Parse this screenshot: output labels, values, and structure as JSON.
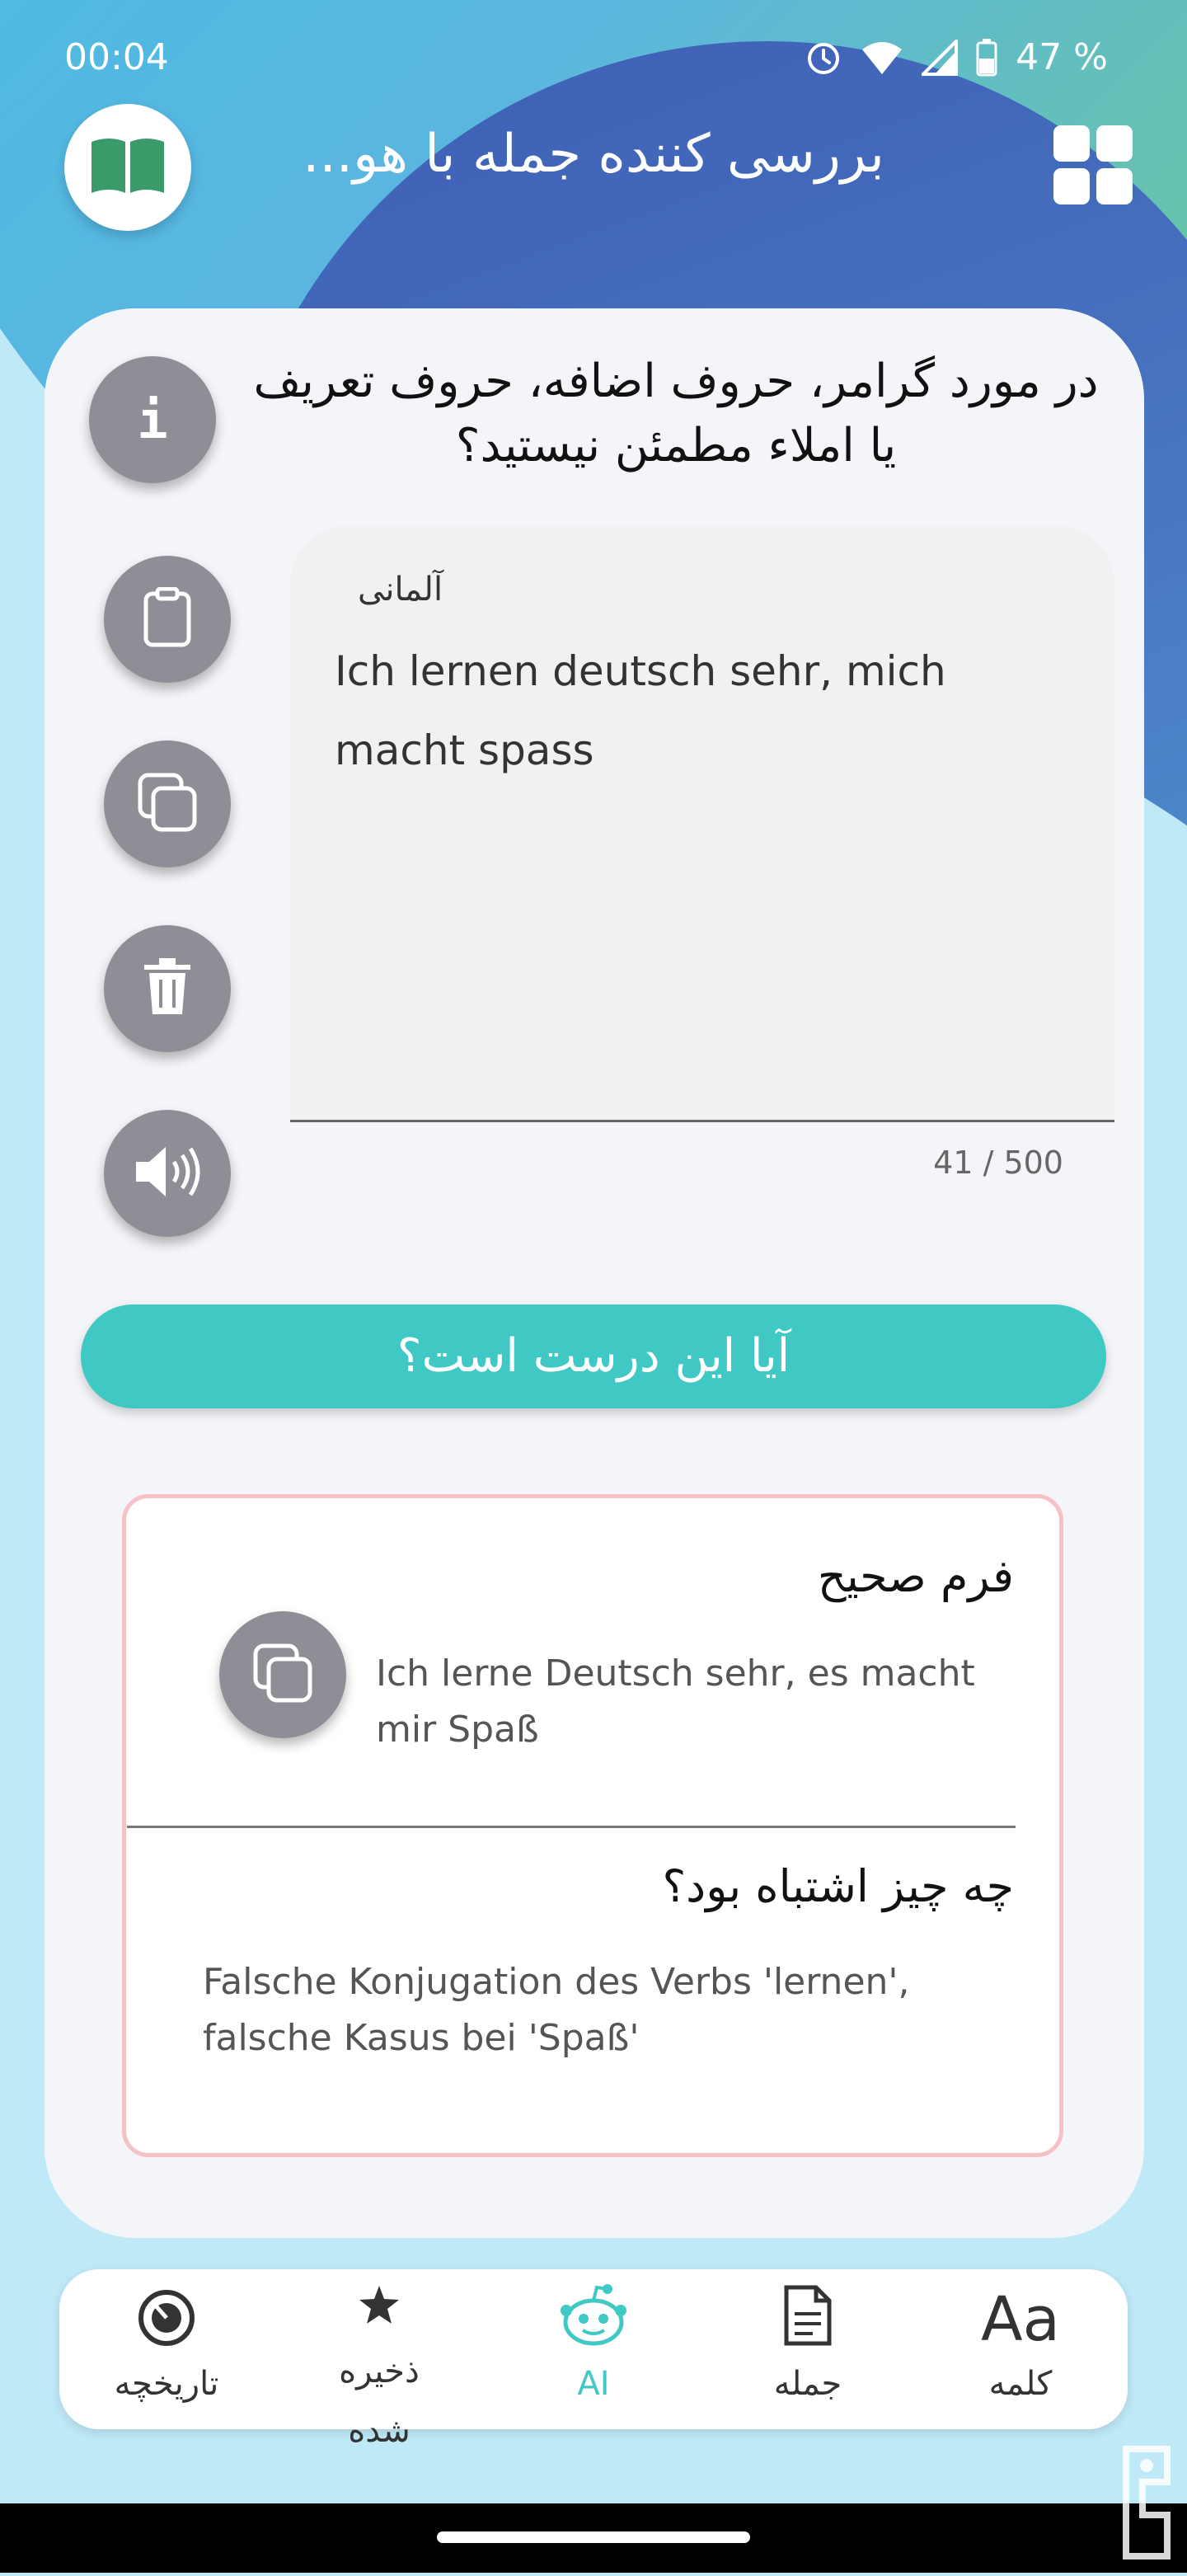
{
  "status_bar": {
    "time": "00:04",
    "battery": "47 %"
  },
  "header": {
    "title": "بررسی کننده جمله با هو..."
  },
  "question": "در مورد گرامر، حروف اضافه، حروف تعریف یا املاء مطمئن نیستید؟",
  "input": {
    "language": "آلمانی",
    "text": "Ich lernen deutsch sehr, mich macht spass",
    "char_count": "41 / 500"
  },
  "check_button": "آیا این درست است؟",
  "result": {
    "correct_title": "فرم صحیح",
    "corrected_text": "Ich lerne Deutsch sehr, es macht mir Spaß",
    "wrong_title": "چه چیز اشتباه بود؟",
    "explanation": "Falsche Konjugation des Verbs 'lernen', falsche Kasus bei 'Spaß'"
  },
  "bottom_nav": {
    "history": "تاریخچه",
    "saved_line1": "ذخیره",
    "saved_line2": "شده",
    "ai": "AI",
    "sentence": "جمله",
    "word": "کلمه",
    "word_icon_text": "Aa"
  },
  "colors": {
    "accent": "#40c9c4",
    "result_border": "#f5c0c6",
    "button_gray": "#8d8e96"
  }
}
